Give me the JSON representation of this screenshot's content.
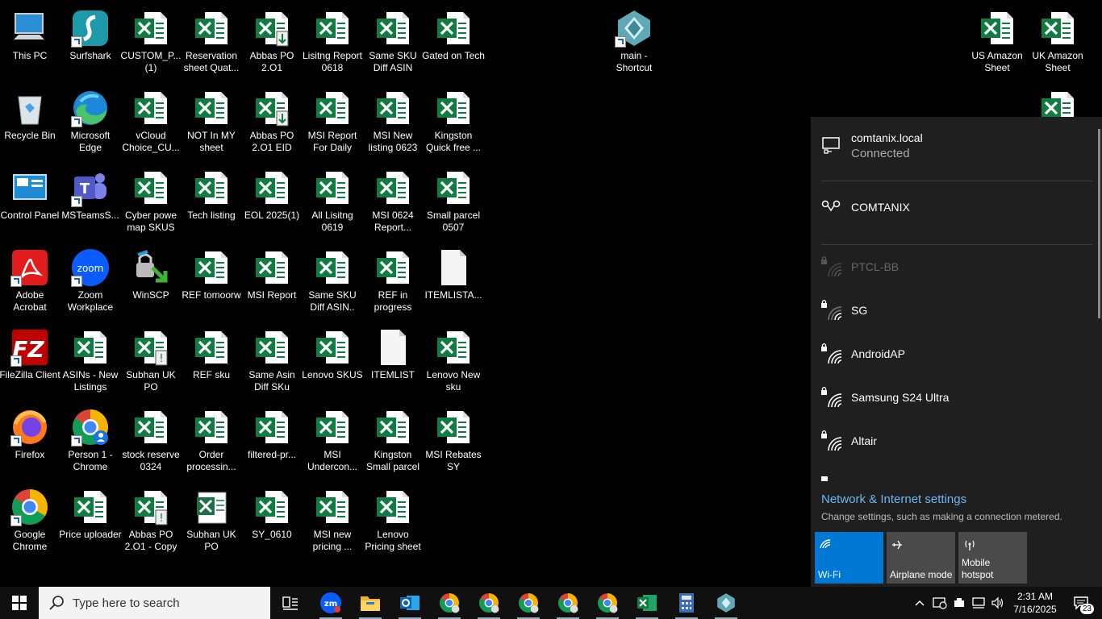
{
  "desktop": {
    "icons": [
      {
        "label": "This PC",
        "type": "pc"
      },
      {
        "label": "Surfshark",
        "type": "surfshark"
      },
      {
        "label": "CUSTOM_P... (1)",
        "type": "excel"
      },
      {
        "label": "Reservation sheet Quat...",
        "type": "excel"
      },
      {
        "label": "Abbas PO 2.O1",
        "type": "excel-dl"
      },
      {
        "label": "Lisitng Report 0618",
        "type": "excel"
      },
      {
        "label": "Same SKU Diff ASIN",
        "type": "excel"
      },
      {
        "label": "Gated on Tech",
        "type": "excel"
      },
      {
        "label": "Recycle Bin",
        "type": "bin"
      },
      {
        "label": "Microsoft Edge",
        "type": "edge"
      },
      {
        "label": "vCloud Choice_CU...",
        "type": "excel"
      },
      {
        "label": "NOT In MY sheet",
        "type": "excel"
      },
      {
        "label": "Abbas PO 2.O1  EID",
        "type": "excel-dl"
      },
      {
        "label": "MSI Report For Daily",
        "type": "excel"
      },
      {
        "label": "MSI New listing 0623",
        "type": "excel"
      },
      {
        "label": "Kingston Quick free ...",
        "type": "excel"
      },
      {
        "label": "Control Panel",
        "type": "control"
      },
      {
        "label": "MSTeamsS...",
        "type": "teams"
      },
      {
        "label": "Cyber powe map SKUS",
        "type": "excel"
      },
      {
        "label": "Tech listing",
        "type": "excel"
      },
      {
        "label": "EOL 2025(1)",
        "type": "excel"
      },
      {
        "label": "All Lisitng 0619",
        "type": "excel"
      },
      {
        "label": "MSI 0624 Report...",
        "type": "excel"
      },
      {
        "label": "Small parcel 0507",
        "type": "excel"
      },
      {
        "label": "Adobe Acrobat",
        "type": "acrobat"
      },
      {
        "label": "Zoom Workplace",
        "type": "zoom"
      },
      {
        "label": "WinSCP",
        "type": "winscp"
      },
      {
        "label": "REF tomoorw",
        "type": "excel"
      },
      {
        "label": "MSI Report",
        "type": "excel"
      },
      {
        "label": "Same SKU Diff ASIN..",
        "type": "excel"
      },
      {
        "label": "REF in progress",
        "type": "excel"
      },
      {
        "label": "ITEMLISTA...",
        "type": "file"
      },
      {
        "label": "FileZilla Client",
        "type": "filezilla"
      },
      {
        "label": "ASINs - New Listings",
        "type": "excel"
      },
      {
        "label": "Subhan UK PO",
        "type": "excel-warn"
      },
      {
        "label": "REF sku",
        "type": "excel"
      },
      {
        "label": "Same Asin Diff SKu",
        "type": "excel"
      },
      {
        "label": "Lenovo SKUS",
        "type": "excel"
      },
      {
        "label": "ITEMLIST",
        "type": "file"
      },
      {
        "label": "Lenovo New sku",
        "type": "excel"
      },
      {
        "label": "Firefox",
        "type": "firefox"
      },
      {
        "label": "Person 1 - Chrome",
        "type": "chrome-person"
      },
      {
        "label": "stock reserve 0324",
        "type": "excel"
      },
      {
        "label": "Order processin...",
        "type": "excel"
      },
      {
        "label": "filtered-pr...",
        "type": "excel"
      },
      {
        "label": "MSI Undercon...",
        "type": "excel"
      },
      {
        "label": "Kingston Small parcel",
        "type": "excel"
      },
      {
        "label": "MSI Rebates SY",
        "type": "excel"
      },
      {
        "label": "Google Chrome",
        "type": "chrome"
      },
      {
        "label": "Price uploader",
        "type": "excel"
      },
      {
        "label": "Abbas PO 2.O1 - Copy",
        "type": "excel-warn"
      },
      {
        "label": "Subhan UK PO",
        "type": "excel-old"
      },
      {
        "label": "SY_0610",
        "type": "excel"
      },
      {
        "label": "MSI new pricing ...",
        "type": "excel"
      },
      {
        "label": "Lenovo Pricing sheet",
        "type": "excel"
      },
      {
        "label": "main - Shortcut",
        "type": "app-diamond"
      },
      {
        "label": "US Amazon Sheet",
        "type": "excel"
      },
      {
        "label": "UK Amazon Sheet",
        "type": "excel"
      }
    ]
  },
  "network_flyout": {
    "connected": {
      "name": "comtanix.local",
      "status": "Connected"
    },
    "dialup": {
      "name": "COMTANIX"
    },
    "wifi_networks": [
      {
        "name": "PTCL-BB",
        "dimmed": true
      },
      {
        "name": "SG",
        "dimmed": false
      },
      {
        "name": "AndroidAP",
        "dimmed": false
      },
      {
        "name": "Samsung S24 Ultra",
        "dimmed": false
      },
      {
        "name": "Altair",
        "dimmed": false
      }
    ],
    "settings_link": "Network & Internet settings",
    "settings_desc": "Change settings, such as making a connection metered.",
    "tiles": [
      {
        "label": "Wi-Fi",
        "active": true,
        "icon": "wifi-icon"
      },
      {
        "label": "Airplane mode",
        "active": false,
        "icon": "airplane-icon"
      },
      {
        "label": "Mobile hotspot",
        "active": false,
        "icon": "hotspot-icon"
      }
    ]
  },
  "taskbar": {
    "search_placeholder": "Type here to search",
    "apps": [
      "task-view",
      "zoom",
      "file-explorer",
      "outlook",
      "chrome-1",
      "chrome-2",
      "chrome-3",
      "chrome-4",
      "chrome-5",
      "excel",
      "calculator",
      "main-app"
    ],
    "clock": {
      "time": "2:31 AM",
      "date": "7/16/2025"
    },
    "notification_count": "23"
  },
  "colors": {
    "excel_green": "#107c41",
    "wifi_blue": "#0078d4",
    "link_blue": "#6cb8f6"
  }
}
